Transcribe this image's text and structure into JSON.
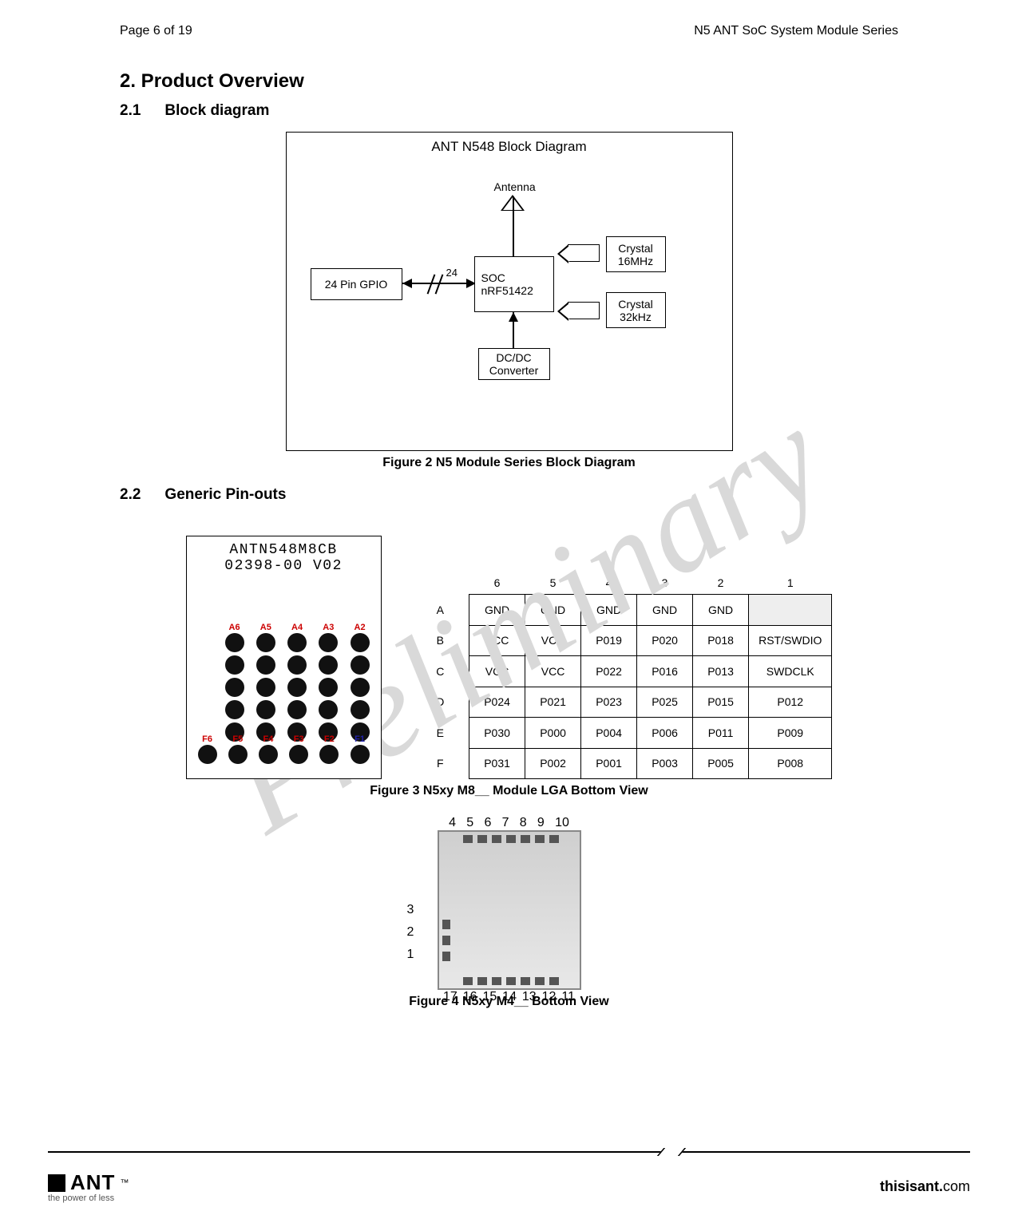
{
  "header": {
    "page": "Page 6 of 19",
    "title": "N5 ANT SoC System Module Series"
  },
  "watermark": "Preliminary",
  "h1": "2.  Product Overview",
  "s21": {
    "num": "2.1",
    "title": "Block diagram"
  },
  "s22": {
    "num": "2.2",
    "title": "Generic Pin-outs"
  },
  "blockdiag": {
    "title": "ANT N548 Block Diagram",
    "antenna": "Antenna",
    "soc_l1": "SOC",
    "soc_l2": "nRF51422",
    "gpio": "24 Pin GPIO",
    "bus24": "24",
    "x16_l1": "Crystal",
    "x16_l2": "16MHz",
    "x32_l1": "Crystal",
    "x32_l2": "32kHz",
    "dcdc_l1": "DC/DC",
    "dcdc_l2": "Converter"
  },
  "fig2": "Figure 2 N5 Module Series Block Diagram",
  "lga": {
    "line1": "ANTN548M8CB",
    "line2": "02398-00  V02",
    "toplabels": [
      "A6",
      "A5",
      "A4",
      "A3",
      "A2"
    ],
    "botlabels": [
      "F6",
      "F5",
      "F4",
      "F3",
      "F2",
      "F1"
    ]
  },
  "pin_cols": [
    "6",
    "5",
    "4",
    "3",
    "2",
    "1"
  ],
  "pin_rows": [
    "A",
    "B",
    "C",
    "D",
    "E",
    "F"
  ],
  "pins": {
    "A": [
      "GND",
      "GND",
      "GND",
      "GND",
      "GND",
      ""
    ],
    "B": [
      "VCC",
      "VCC",
      "P019",
      "P020",
      "P018",
      "RST/SWDIO"
    ],
    "C": [
      "VCC",
      "VCC",
      "P022",
      "P016",
      "P013",
      "SWDCLK"
    ],
    "D": [
      "P024",
      "P021",
      "P023",
      "P025",
      "P015",
      "P012"
    ],
    "E": [
      "P030",
      "P000",
      "P004",
      "P006",
      "P011",
      "P009"
    ],
    "F": [
      "P031",
      "P002",
      "P001",
      "P003",
      "P005",
      "P008"
    ]
  },
  "fig3": "Figure 3 N5xy M8__ Module LGA Bottom View",
  "m4": {
    "top": [
      "4",
      "5",
      "6",
      "7",
      "8",
      "9",
      "10"
    ],
    "left": [
      "3",
      "2",
      "1"
    ],
    "bot": [
      "17",
      "16",
      "15",
      "14",
      "13",
      "12",
      "11"
    ]
  },
  "fig4": "Figure 4 N5xy M4__ Bottom View",
  "footer": {
    "logo": "ANT",
    "tag": "the power of less",
    "site_bold": "thisisant.",
    "site_rest": "com"
  }
}
